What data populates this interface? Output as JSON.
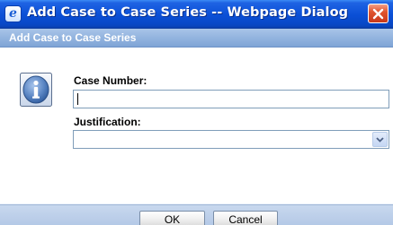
{
  "window": {
    "title": "Add Case to Case Series -- Webpage Dialog",
    "icon": "ie-icon",
    "close_icon": "close-icon"
  },
  "section": {
    "header": "Add Case to Case Series",
    "icon": "info-icon"
  },
  "form": {
    "case_number": {
      "label": "Case Number:",
      "value": "",
      "placeholder": ""
    },
    "justification": {
      "label": "Justification:",
      "selected": ""
    }
  },
  "buttons": {
    "ok": "OK",
    "cancel": "Cancel"
  },
  "colors": {
    "titlebar": "#0a4fd6",
    "header": "#8fb0dc",
    "close": "#d9452a"
  }
}
